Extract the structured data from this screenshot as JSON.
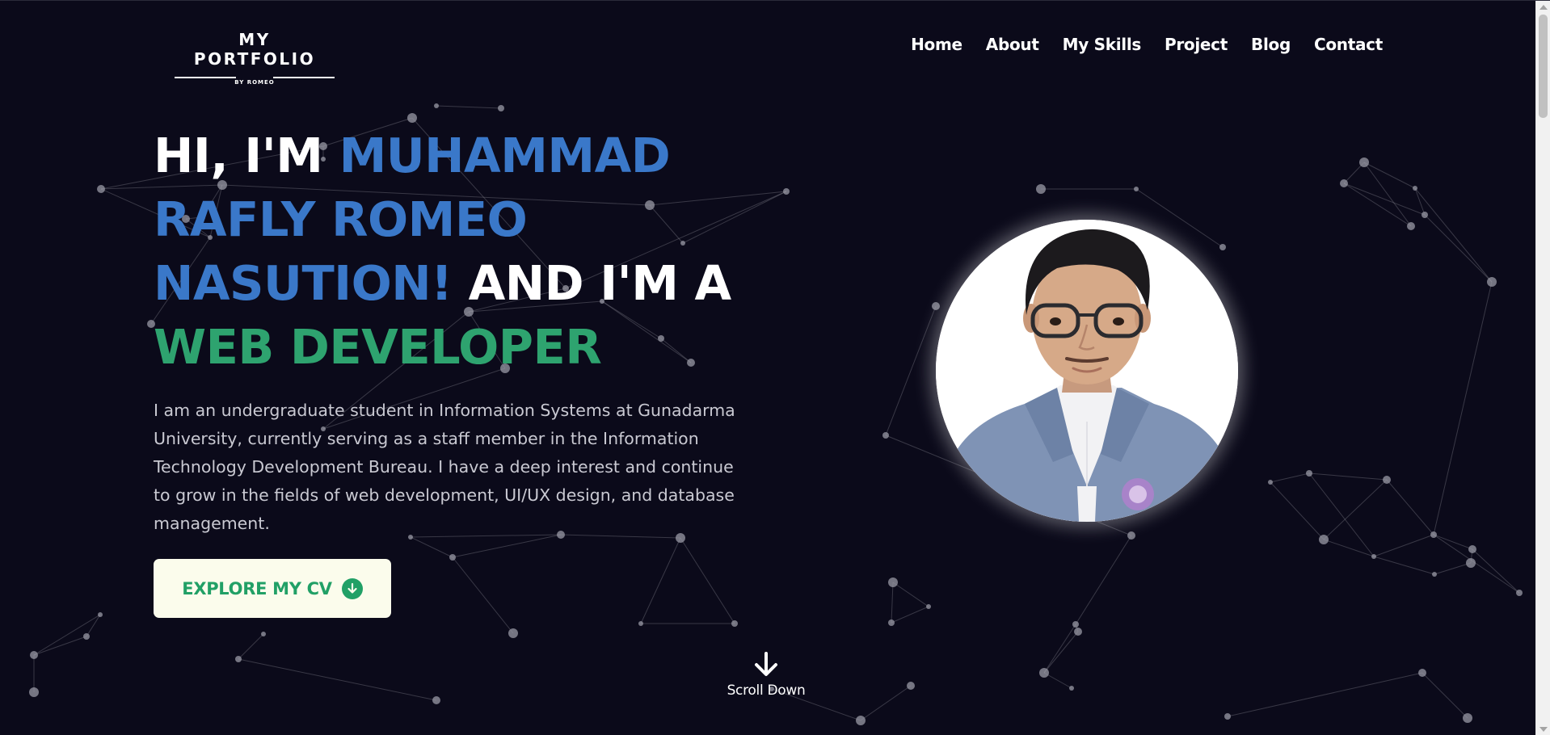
{
  "logo": {
    "title": "MY PORTFOLIO",
    "subtitle": "BY ROMEO"
  },
  "nav": {
    "items": [
      "Home",
      "About",
      "My Skills",
      "Project",
      "Blog",
      "Contact"
    ]
  },
  "hero": {
    "greeting": "HI, I'M ",
    "name": "MUHAMMAD RAFLY ROMEO NASUTION!",
    "connector": " AND I'M A ",
    "role": "WEB DEVELOPER",
    "description": "I am an undergraduate student in Information Systems at Gunadarma University, currently serving as a staff member in the Information Technology Development Bureau. I have a deep interest and continue to grow in the fields of web development, UI/UX design, and database management.",
    "button_label": "EXPLORE MY CV",
    "button_icon": "arrow-down-circle-icon"
  },
  "scroll_down": {
    "label": "Scroll Down",
    "icon": "arrow-down-icon"
  },
  "colors": {
    "background": "#0b0a1a",
    "accent_blue": "#3a78c9",
    "accent_green": "#2ea36f",
    "button_bg": "#fbfcec",
    "particle": "#9a9aa6"
  }
}
